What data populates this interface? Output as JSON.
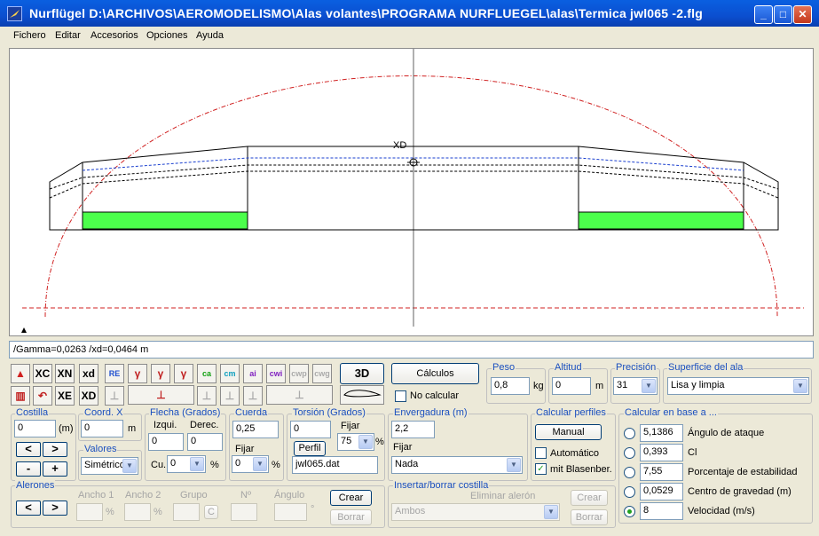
{
  "window": {
    "title": "Nurflügel   D:\\ARCHIVOS\\AEROMODELISMO\\Alas volantes\\PROGRAMA NURFLUEGEL\\alas\\Termica jwl065 -2.flg",
    "minimize": "_",
    "maximize": "□",
    "close": "✕"
  },
  "menu": [
    "Fichero",
    "Editar",
    "Accesorios",
    "Opciones",
    "Ayuda"
  ],
  "canvas": {
    "label": "XD"
  },
  "status_text": "/Gamma=0,0263 /xd=0,0464 m",
  "toolbar": {
    "row1": [
      "XC",
      "XN",
      "xd",
      "RE",
      "γ",
      "γ",
      "γ",
      "ca",
      "cm",
      "ai",
      "cwi",
      "cwp",
      "cwg"
    ],
    "row2": [
      "XE",
      "XD"
    ],
    "btn_3d": "3D",
    "btn_calculos": "Cálculos",
    "no_calcular": "No calcular"
  },
  "peso": {
    "label": "Peso",
    "value": "0,8",
    "unit": "kg"
  },
  "altitud": {
    "label": "Altitud",
    "value": "0",
    "unit": "m"
  },
  "precision": {
    "label": "Precisión",
    "value": "31"
  },
  "superficie": {
    "label": "Superficie del ala",
    "value": "Lisa y limpia"
  },
  "costilla": {
    "label": "Costilla",
    "value": "0",
    "unit": "(m)",
    "prev": "<",
    "next": ">",
    "minus": "-",
    "plus": "+"
  },
  "coord_x": {
    "label": "Coord. X",
    "value": "0",
    "unit": "m"
  },
  "valores": {
    "label": "Valores",
    "value": "Simétrico"
  },
  "flecha": {
    "label": "Flecha (Grados)",
    "izq_label": "Izqui.",
    "der_label": "Derec.",
    "izq": "0",
    "der": "0",
    "cu_label": "Cu.",
    "cu": "0",
    "pct": "%"
  },
  "cuerda": {
    "label": "Cuerda",
    "value": "0,25",
    "fijar": "Fijar",
    "fijar_value": "0",
    "pct": "%"
  },
  "torsion": {
    "label": "Torsión (Grados)",
    "value": "0",
    "fijar": "Fijar",
    "fijar_value": "75",
    "pct": "%",
    "perfil_btn": "Perfil",
    "perfil_file": "jwl065.dat"
  },
  "envergadura": {
    "label": "Envergadura (m)",
    "value": "2,2",
    "fijar": "Fijar",
    "fijar_value": "Nada"
  },
  "calc_perfiles": {
    "label": "Calcular perfiles",
    "manual": "Manual",
    "automatico": "Automático",
    "blasenber": "mit Blasenber.",
    "automatico_checked": false,
    "blasenber_checked": true
  },
  "calc_base": {
    "label": "Calcular en base a ...",
    "rows": [
      {
        "value": "5,1386",
        "label": "Ángulo de ataque",
        "selected": false
      },
      {
        "value": "0,393",
        "label": "Cl",
        "selected": false
      },
      {
        "value": "7,55",
        "label": "Porcentaje de estabilidad",
        "selected": false
      },
      {
        "value": "0,0529",
        "label": "Centro de gravedad (m)",
        "selected": false
      },
      {
        "value": "8",
        "label": "Velocidad (m/s)",
        "selected": true
      }
    ]
  },
  "alerones": {
    "label": "Alerones",
    "prev": "<",
    "next": ">",
    "ancho1": "Ancho 1",
    "ancho2": "Ancho 2",
    "grupo": "Grupo",
    "numero": "Nº",
    "angulo": "Ángulo",
    "pct": "%",
    "c": "C",
    "deg": "°",
    "crear": "Crear",
    "borrar": "Borrar"
  },
  "costilla_ins": {
    "label": "Insertar/borrar costilla",
    "eliminar": "Eliminar alerón",
    "value": "Ambos",
    "crear": "Crear",
    "borrar": "Borrar"
  }
}
